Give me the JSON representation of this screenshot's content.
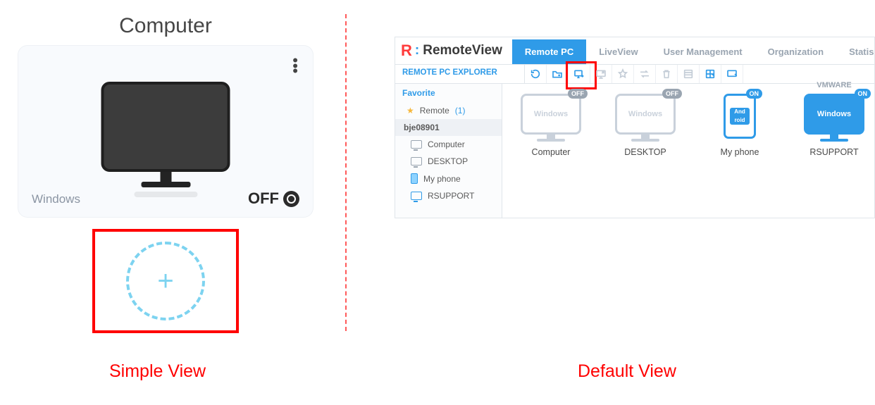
{
  "left": {
    "title": "Computer",
    "os": "Windows",
    "status": "OFF"
  },
  "captions": {
    "simple": "Simple View",
    "default": "Default View"
  },
  "app": {
    "brand": "RemoteView",
    "tabs": {
      "remote": "Remote PC",
      "live": "LiveView",
      "user": "User Management",
      "org": "Organization",
      "stats": "Statis"
    },
    "explorer_label": "REMOTE PC EXPLORER",
    "tree": {
      "favorite": "Favorite",
      "remote_name": "Remote",
      "remote_count": "(1)",
      "user": "bje08901",
      "items": [
        "Computer",
        "DESKTOP",
        "My phone",
        "RSUPPORT"
      ]
    },
    "devices": {
      "d1": {
        "name": "Computer",
        "os": "Windows",
        "state": "OFF"
      },
      "d2": {
        "name": "DESKTOP",
        "os": "Windows",
        "state": "OFF"
      },
      "d3": {
        "name": "My phone",
        "os_a": "And",
        "os_b": "roid",
        "state": "ON"
      },
      "d4": {
        "name": "RSUPPORT",
        "os": "Windows",
        "state": "ON",
        "vm": "VMWARE"
      }
    }
  }
}
